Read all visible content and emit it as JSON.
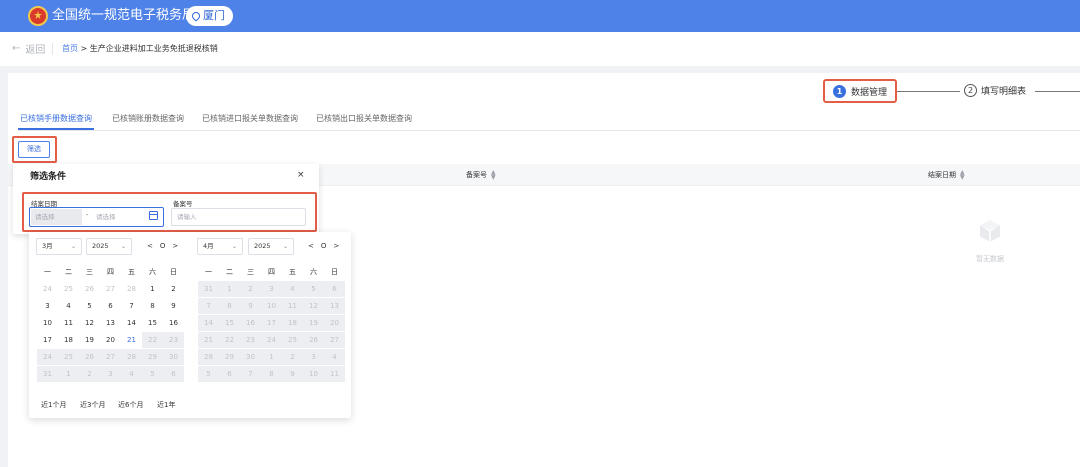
{
  "header": {
    "title": "全国统一规范电子税务局",
    "city": "厦门"
  },
  "nav": {
    "back": "返回",
    "breadcrumb_home": "首页",
    "breadcrumb_sep": ">",
    "breadcrumb_current": "生产企业进料加工业务免抵退税核销"
  },
  "steps": [
    {
      "num": "1",
      "label": "数据管理"
    },
    {
      "num": "2",
      "label": "填写明细表"
    }
  ],
  "tabs": [
    "已核销手册数据查询",
    "已核销账册数据查询",
    "已核销进口报关单数据查询",
    "已核销出口报关单数据查询"
  ],
  "filter_button": "筛选",
  "table": {
    "columns": [
      "备案号",
      "结案日期"
    ]
  },
  "empty_text": "暂无数据",
  "filter_panel": {
    "title": "筛选条件",
    "close": "×",
    "date_label": "结案日期",
    "start_placeholder": "请选择",
    "sep": "-",
    "end_placeholder": "请选择",
    "record_label": "备案号",
    "record_placeholder": "请输入"
  },
  "calendar": {
    "weekdays": [
      "一",
      "二",
      "三",
      "四",
      "五",
      "六",
      "日"
    ],
    "left": {
      "month": "3月",
      "year": "2025"
    },
    "right": {
      "month": "4月",
      "year": "2025"
    },
    "nav": [
      "<",
      "O",
      ">"
    ],
    "left_days": [
      [
        "24",
        "25",
        "26",
        "27",
        "28",
        "1",
        "2"
      ],
      [
        "3",
        "4",
        "5",
        "6",
        "7",
        "8",
        "9"
      ],
      [
        "10",
        "11",
        "12",
        "13",
        "14",
        "15",
        "16"
      ],
      [
        "17",
        "18",
        "19",
        "20",
        "21",
        "22",
        "23"
      ],
      [
        "24",
        "25",
        "26",
        "27",
        "28",
        "29",
        "30"
      ],
      [
        "31",
        "1",
        "2",
        "3",
        "4",
        "5",
        "6"
      ]
    ],
    "right_days": [
      [
        "31",
        "1",
        "2",
        "3",
        "4",
        "5",
        "6"
      ],
      [
        "7",
        "8",
        "9",
        "10",
        "11",
        "12",
        "13"
      ],
      [
        "14",
        "15",
        "16",
        "17",
        "18",
        "19",
        "20"
      ],
      [
        "21",
        "22",
        "23",
        "24",
        "25",
        "26",
        "27"
      ],
      [
        "28",
        "29",
        "30",
        "1",
        "2",
        "3",
        "4"
      ],
      [
        "5",
        "6",
        "7",
        "8",
        "9",
        "10",
        "11"
      ]
    ],
    "today": "21",
    "quick": [
      "近1个月",
      "近3个月",
      "近6个月",
      "近1年"
    ]
  },
  "colors": {
    "header": "#4f82e8",
    "accent": "#3a6fe0",
    "highlight_box": "#e35d47"
  }
}
